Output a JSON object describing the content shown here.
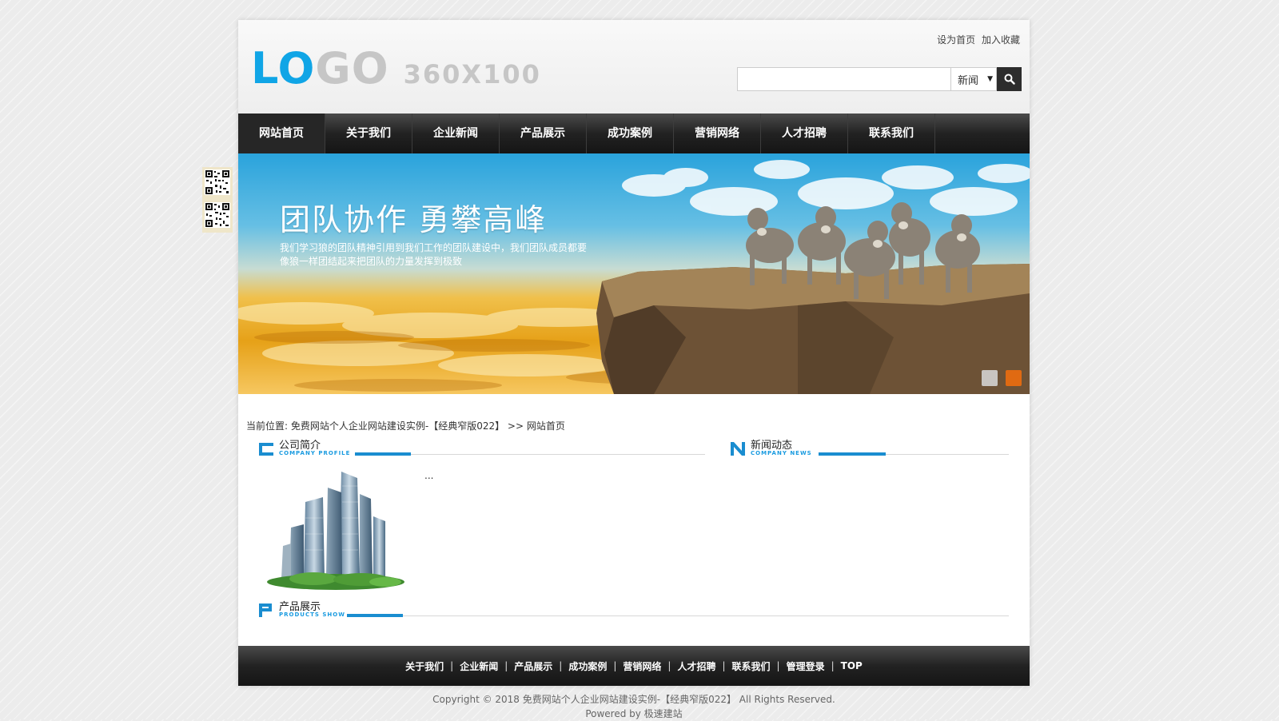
{
  "header": {
    "logo": {
      "part1": "LO",
      "part2": "GO",
      "part3": "360X100"
    },
    "top_links": [
      "设为首页",
      "加入收藏"
    ],
    "search": {
      "placeholder": "",
      "value": "",
      "category_selected": "新闻"
    }
  },
  "nav": {
    "items": [
      "网站首页",
      "关于我们",
      "企业新闻",
      "产品展示",
      "成功案例",
      "营销网络",
      "人才招聘",
      "联系我们"
    ],
    "active_index": 0
  },
  "banner": {
    "title": "团队协作 勇攀高峰",
    "desc_line1": "我们学习狼的团队精神引用到我们工作的团队建设中，我们团队成员都要",
    "desc_line2": "像狼一样团结起来把团队的力量发挥到极致",
    "slides_count": 2,
    "active_slide": 2
  },
  "breadcrumb": {
    "prefix": "当前位置: ",
    "site": "免费网站个人企业网站建设实例-【经典窄版022】",
    "separator": " >> ",
    "current": "网站首页"
  },
  "sections": {
    "company": {
      "title": "公司简介",
      "subtitle": "COMPANY PROFILE",
      "icon_letter": "C",
      "excerpt": "..."
    },
    "news": {
      "title": "新闻动态",
      "subtitle": "COMPANY NEWS",
      "icon_letter": "N"
    },
    "products": {
      "title": "产品展示",
      "subtitle": "PRODUCTS SHOW",
      "icon_letter": "P"
    }
  },
  "footer": {
    "links": [
      "关于我们",
      "企业新闻",
      "产品展示",
      "成功案例",
      "营销网络",
      "人才招聘",
      "联系我们",
      "管理登录",
      "TOP"
    ],
    "copyright": "Copyright © 2018 免费网站个人企业网站建设实例-【经典窄版022】 All Rights Reserved.",
    "powered_by": "Powered by 极速建站"
  },
  "colors": {
    "accent": "#1a8dd0",
    "logo_blue": "#10a5e6",
    "nav_bg": "#222222",
    "slide_active": "#e06a12"
  },
  "icons": [
    "search-icon",
    "qr-code-icon"
  ]
}
